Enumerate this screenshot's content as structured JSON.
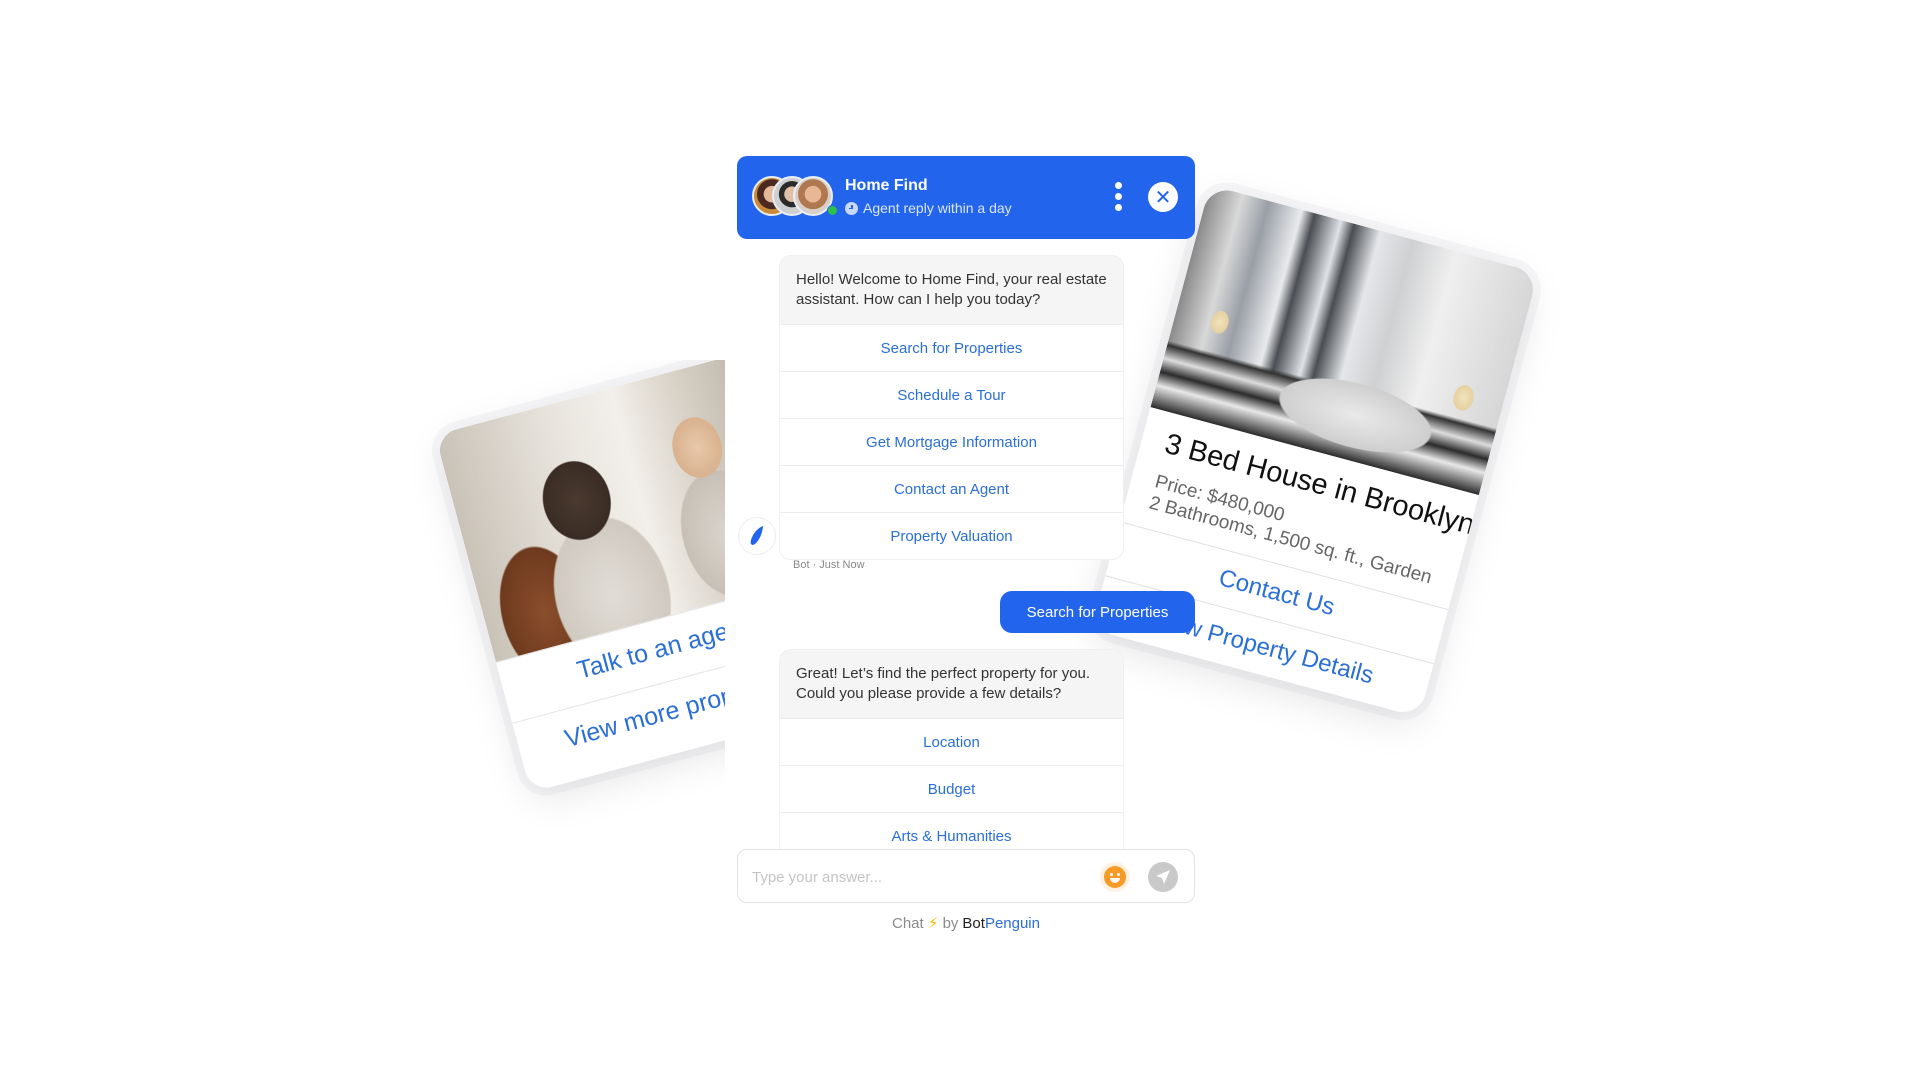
{
  "chat": {
    "header": {
      "title": "Home Find",
      "subtitle": "Agent reply within a day",
      "brand_color": "#2265ec",
      "online_color": "#2ec14a"
    },
    "messages": [
      {
        "sender": "bot",
        "text": "Hello! Welcome to Home Find, your real estate assistant. How can I help you today?",
        "options": [
          "Search for Properties",
          "Schedule a Tour",
          "Get Mortgage Information",
          "Contact an Agent",
          "Property Valuation"
        ],
        "meta": "Bot · Just Now"
      },
      {
        "sender": "user",
        "text": "Search for Properties"
      },
      {
        "sender": "bot",
        "text": "Great! Let’s find the perfect property for you. Could you please provide a few details?",
        "options": [
          "Location",
          "Budget",
          "Arts & Humanities"
        ]
      }
    ],
    "input": {
      "placeholder": "Type your answer...",
      "value": ""
    },
    "powered_by": {
      "prefix": "Chat",
      "bolt": "⚡",
      "by": "by",
      "brand_a": "Bot",
      "brand_b": "Penguin"
    }
  },
  "property_card": {
    "title": "3 Bed House in Brooklyn",
    "price": "Price: $480,000",
    "details": "2 Bathrooms, 1,500 sq. ft., Garden",
    "options": [
      "Contact Us",
      "View Property Details"
    ]
  },
  "agent_card": {
    "options": [
      "Talk to an agent",
      "View more properties"
    ]
  },
  "icons": {
    "clock": "clock-icon",
    "menu": "kebab-menu-icon",
    "close": "close-icon",
    "bot": "penguin-icon",
    "emoji": "emoji-icon",
    "send": "send-icon"
  }
}
